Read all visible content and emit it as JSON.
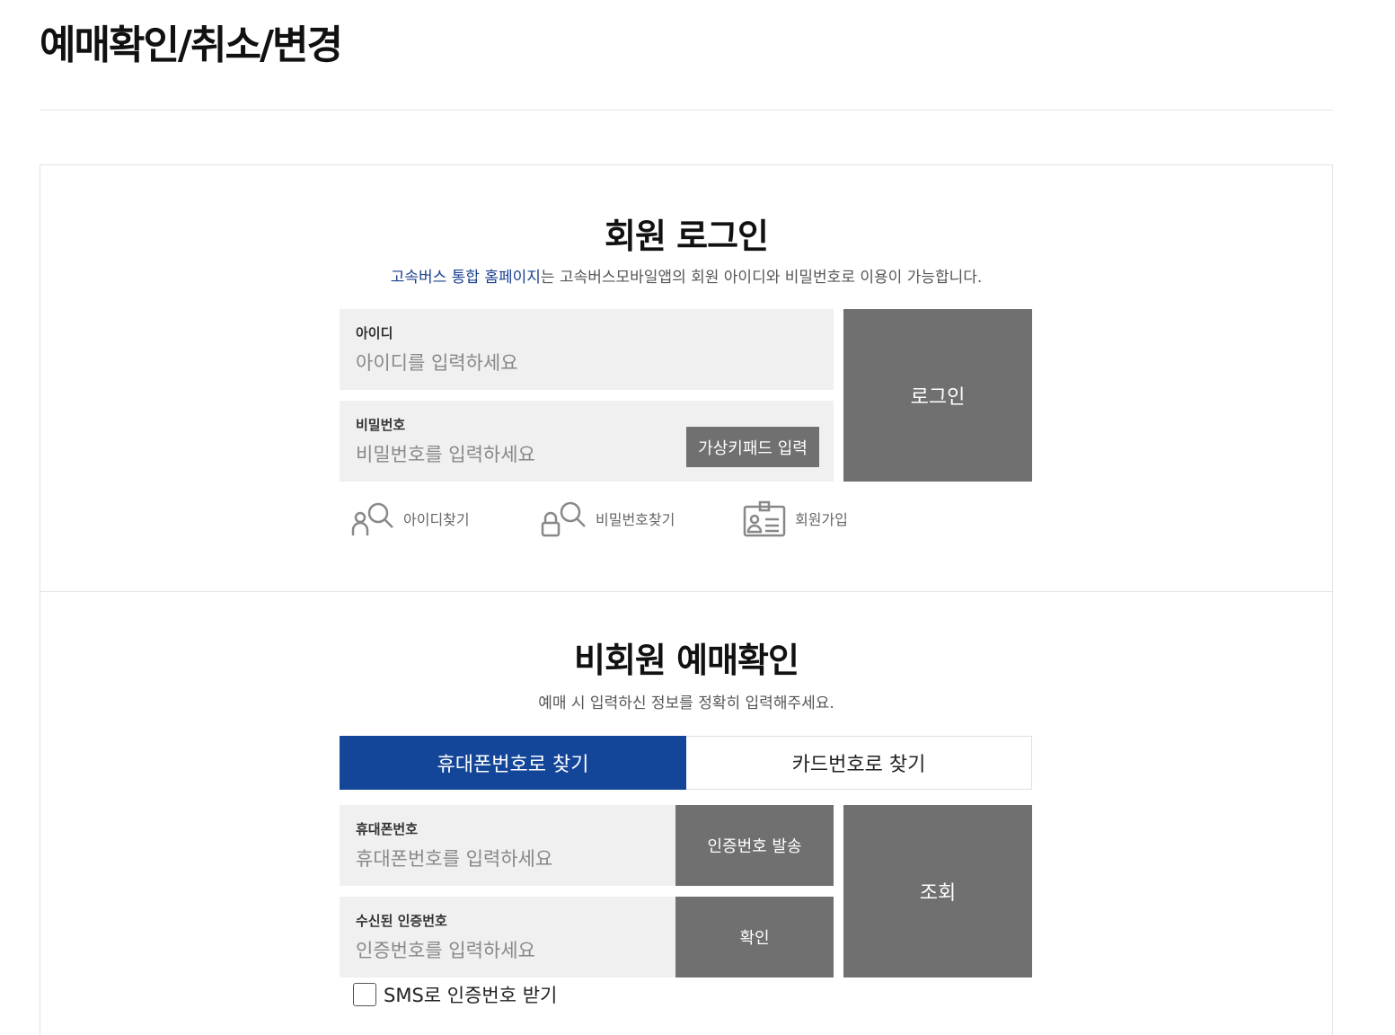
{
  "page": {
    "title": "예매확인/취소/변경"
  },
  "member": {
    "title": "회원 로그인",
    "desc_highlight": "고속버스 통합 홈페이지",
    "desc_rest": "는 고속버스모바일앱의 회원 아이디와 비밀번호로 이용이 가능합니다.",
    "id_label": "아이디",
    "id_placeholder": "아이디를 입력하세요",
    "pw_label": "비밀번호",
    "pw_placeholder": "비밀번호를 입력하세요",
    "keypad_label": "가상키패드 입력",
    "login_label": "로그인",
    "links": {
      "find_id": "아이디찾기",
      "find_pw": "비밀번호찾기",
      "signup": "회원가입"
    }
  },
  "guest": {
    "title": "비회원 예매확인",
    "desc": "예매 시 입력하신 정보를 정확히 입력해주세요.",
    "tabs": [
      {
        "label": "휴대폰번호로 찾기",
        "active": true
      },
      {
        "label": "카드번호로 찾기",
        "active": false
      }
    ],
    "phone_label": "휴대폰번호",
    "phone_placeholder": "휴대폰번호를 입력하세요",
    "send_code_label": "인증번호 발송",
    "code_label": "수신된 인증번호",
    "code_placeholder": "인증번호를 입력하세요",
    "confirm_label": "확인",
    "search_label": "조회",
    "sms_label": "SMS로 인증번호 받기"
  },
  "colors": {
    "accent": "#134699",
    "button_gray": "#707070",
    "field_bg": "#f0f0f0",
    "link_blue": "#1a3f8f"
  }
}
